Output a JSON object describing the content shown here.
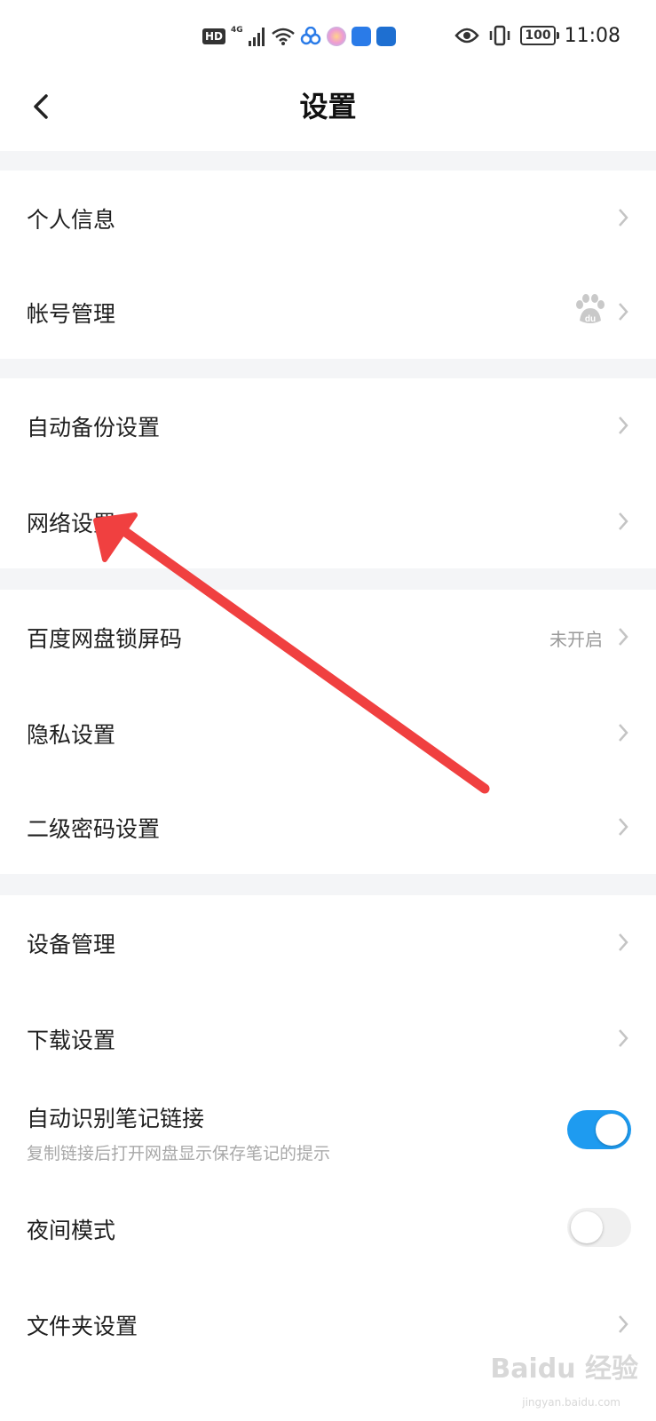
{
  "status_bar": {
    "hd": "HD",
    "network": "4G",
    "battery": "100",
    "time": "11:08"
  },
  "header": {
    "title": "设置",
    "back_icon": "chevron-left-icon"
  },
  "sections": {
    "s1": [
      {
        "label": "个人信息"
      },
      {
        "label": "帐号管理",
        "icon": "baidu-paw-icon"
      }
    ],
    "s2": [
      {
        "label": "自动备份设置"
      },
      {
        "label": "网络设置"
      }
    ],
    "s3": [
      {
        "label": "百度网盘锁屏码",
        "value": "未开启"
      },
      {
        "label": "隐私设置"
      },
      {
        "label": "二级密码设置"
      }
    ],
    "s4": [
      {
        "label": "设备管理"
      },
      {
        "label": "下载设置"
      },
      {
        "label": "自动识别笔记链接",
        "sub": "复制链接后打开网盘显示保存笔记的提示",
        "toggle": true
      },
      {
        "label": "夜间模式",
        "toggle": false
      },
      {
        "label": "文件夹设置"
      }
    ]
  },
  "annotation": {
    "arrow_color": "#f04040"
  },
  "watermark": {
    "text": "Baidu 经验",
    "sub": "jingyan.baidu.com"
  },
  "colors": {
    "accent": "#1e9bf0",
    "separator": "#f4f5f7",
    "chevron": "#c4c4c4"
  }
}
